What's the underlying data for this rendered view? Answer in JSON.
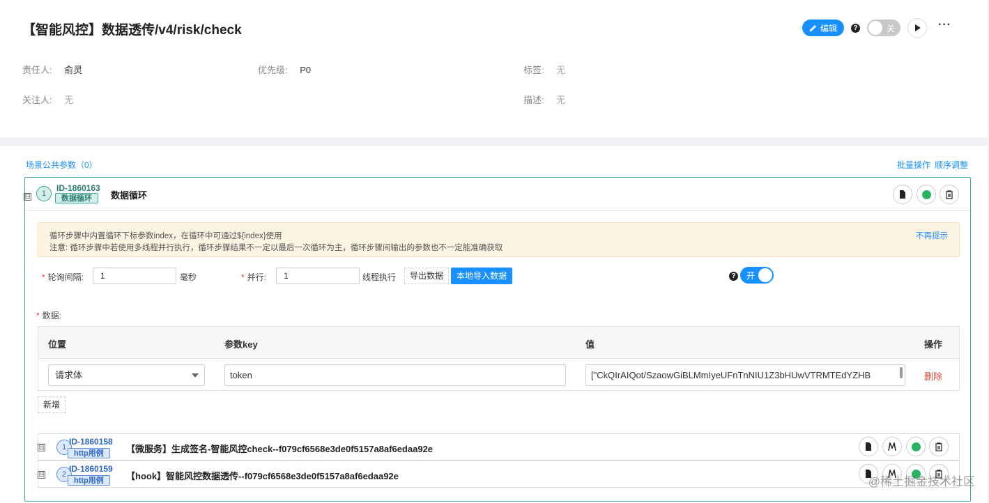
{
  "header": {
    "title": "【智能风控】数据透传/v4/risk/check",
    "edit_label": "编辑",
    "help": "?",
    "switch_label": "关",
    "more": "···",
    "meta": {
      "owner_label": "责任人:",
      "owner_value": "俞灵",
      "priority_label": "优先级:",
      "priority_value": "P0",
      "tags_label": "标签:",
      "tags_value": "无",
      "followers_label": "关注人:",
      "followers_value": "无",
      "desc_label": "描述:",
      "desc_value": "无"
    }
  },
  "main": {
    "scene_params": "场景公共参数（0）",
    "batch_ops": "批量操作",
    "order_adjust": "顺序调整",
    "loop": {
      "fold": "日",
      "num": "1",
      "id": "ID-1860163",
      "tag": "数据循环",
      "title": "数据循环",
      "notice_line1": "循环步骤中内置循环下标参数index，在循环中可通过${index}使用",
      "notice_line2": "注意: 循环步骤中若使用多线程并行执行，循环步骤结果不一定以最后一次循环为主，循环步骤间输出的参数也不一定能准确获取",
      "notice_dismiss": "不再提示",
      "req_mark": "*",
      "interval_label": "轮询间隔:",
      "interval_value": "1",
      "interval_unit": "毫秒",
      "parallel_label": "并行:",
      "parallel_value": "1",
      "parallel_unit": "线程执行",
      "export_label": "导出数据",
      "import_label": "本地导入数据",
      "help": "?",
      "switch_label": "开",
      "data_label": "数据:",
      "table": {
        "col_position": "位置",
        "col_key": "参数key",
        "col_value": "值",
        "col_ops": "操作",
        "rows": [
          {
            "position": "请求体",
            "key": "token",
            "value": "[\"CkQIrAIQot/SzaowGiBLMmIyeUFnTnNIU1Z3bHUwVTRMTEdYZHB",
            "op": "删除"
          }
        ]
      },
      "add_label": "新增",
      "children": [
        {
          "fold": "日",
          "num": "1",
          "id": "ID-1860158",
          "tag": "http用例",
          "title": "【微服务】生成签名-智能风控check--f079cf6568e3de0f5157a8af6edaa92e"
        },
        {
          "fold": "日",
          "num": "2",
          "id": "ID-1860159",
          "tag": "http用例",
          "title": "【hook】智能风控数据透传--f079cf6568e3de0f5157a8af6edaa92e"
        }
      ]
    }
  },
  "watermark": "@稀土掘金技术社区"
}
